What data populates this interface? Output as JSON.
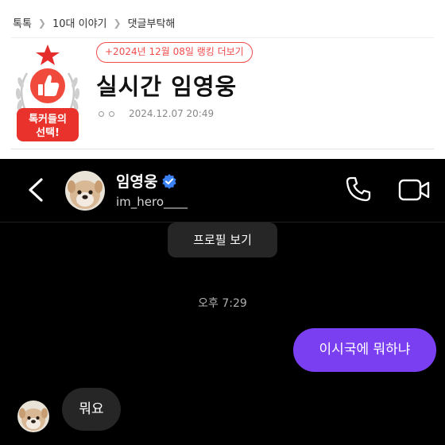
{
  "breadcrumb": {
    "items": [
      "톡톡",
      "10대 이야기",
      "댓글부탁해"
    ]
  },
  "badge": {
    "line1": "톡커들의",
    "line2": "선택!"
  },
  "article": {
    "ranking_link": "+2024년 12월 08일 랭킹 더보기",
    "title": "실시간 임영웅",
    "datetime": "2024.12.07 20:49"
  },
  "chat": {
    "contact_name": "임영웅",
    "contact_handle": "im_hero____",
    "verified": true,
    "profile_button": "프로필 보기",
    "timestamp": "오후 7:29",
    "messages": [
      {
        "from": "me",
        "text": "이시국에 뭐하냐"
      },
      {
        "from": "them",
        "text": "뭐요"
      }
    ],
    "colors": {
      "background": "#000000",
      "my_bubble": "#7b3ff2",
      "their_bubble": "#262626",
      "verified": "#3b82f6"
    }
  },
  "icons": [
    "star-icon",
    "thumbs-up-icon",
    "laurel-icon",
    "back-arrow-icon",
    "verified-icon",
    "phone-icon",
    "video-call-icon"
  ]
}
